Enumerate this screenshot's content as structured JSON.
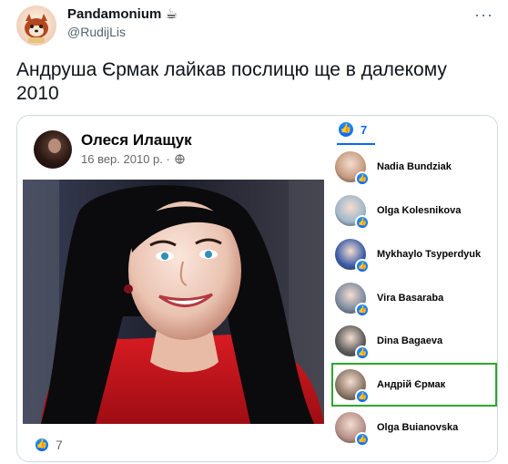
{
  "tweet": {
    "author_name": "Pandamonium",
    "author_emoji": "☕",
    "author_handle": "@RudijLis",
    "more_icon": "more-dots-icon",
    "text": "Андруша Єрмак лайкав послицю ще в далекому 2010"
  },
  "fb_post": {
    "author": "Олеся Илащук",
    "date": "16 вер. 2010 р. ·",
    "privacy_icon": "globe-icon",
    "like_count": "7"
  },
  "likers_panel": {
    "count": "7",
    "items": [
      {
        "name": "Nadia Bundziak",
        "color": "#c49a7e"
      },
      {
        "name": "Olga Kolesnikova",
        "color": "#9fb7c9"
      },
      {
        "name": "Mykhaylo Tsyperdyuk",
        "color": "#3a5ba8"
      },
      {
        "name": "Vira Basaraba",
        "color": "#7c8aa0"
      },
      {
        "name": "Dina Bagaeva",
        "color": "#5a5a5a"
      },
      {
        "name": "Андрій Єрмак",
        "color": "#8a7563",
        "highlight": true
      },
      {
        "name": "Olga Buianovska",
        "color": "#b58f86"
      }
    ]
  },
  "colors": {
    "like_blue": "#0866ff",
    "highlight_green": "#2fa52f",
    "photo_dress": "#c4121a"
  }
}
